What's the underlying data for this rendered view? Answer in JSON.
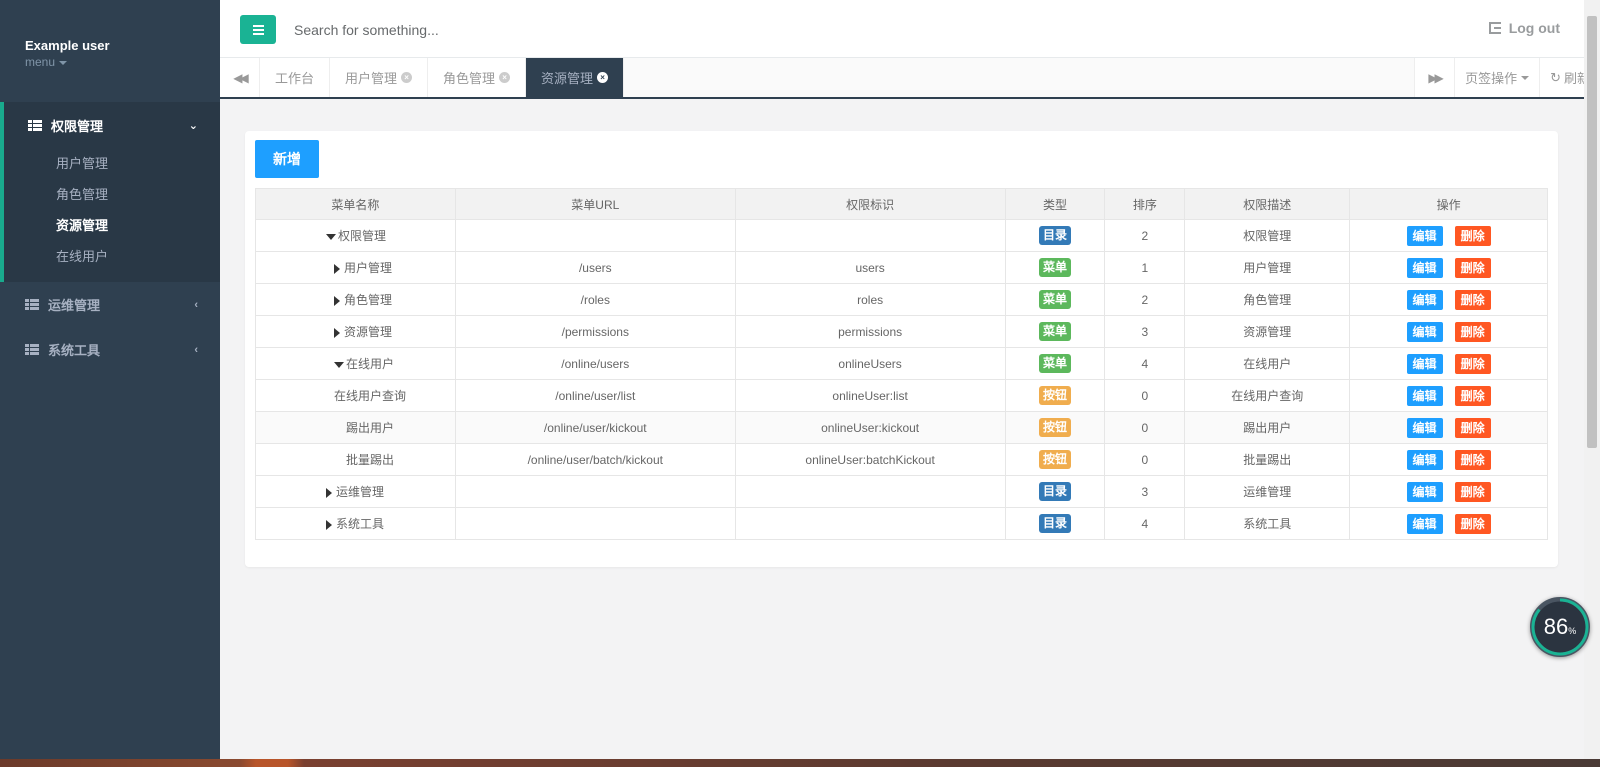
{
  "profile": {
    "name": "Example user",
    "menu_label": "menu"
  },
  "sidebar": {
    "groups": [
      {
        "label": "权限管理",
        "items": [
          "用户管理",
          "角色管理",
          "资源管理",
          "在线用户"
        ]
      },
      {
        "label": "运维管理"
      },
      {
        "label": "系统工具"
      }
    ]
  },
  "topbar": {
    "search_placeholder": "Search for something...",
    "logout_label": "Log out"
  },
  "tabs": {
    "items": [
      "工作台",
      "用户管理",
      "角色管理",
      "资源管理"
    ],
    "active_index": 3,
    "page_ops_label": "页签操作",
    "refresh_label": "刷新"
  },
  "toolbar": {
    "add_label": "新增"
  },
  "table": {
    "headers": [
      "菜单名称",
      "菜单URL",
      "权限标识",
      "类型",
      "排序",
      "权限描述",
      "操作"
    ],
    "edit_label": "编辑",
    "delete_label": "删除",
    "rows": [
      {
        "name": "权限管理",
        "url": "",
        "perm": "",
        "type": "目录",
        "type_kind": "dir",
        "sort": "2",
        "desc": "权限管理",
        "toggle": "down"
      },
      {
        "name": "用户管理",
        "url": "/users",
        "perm": "users",
        "type": "菜单",
        "type_kind": "menu",
        "sort": "1",
        "desc": "用户管理",
        "toggle": "right"
      },
      {
        "name": "角色管理",
        "url": "/roles",
        "perm": "roles",
        "type": "菜单",
        "type_kind": "menu",
        "sort": "2",
        "desc": "角色管理",
        "toggle": "right"
      },
      {
        "name": "资源管理",
        "url": "/permissions",
        "perm": "permissions",
        "type": "菜单",
        "type_kind": "menu",
        "sort": "3",
        "desc": "资源管理",
        "toggle": "right"
      },
      {
        "name": "在线用户",
        "url": "/online/users",
        "perm": "onlineUsers",
        "type": "菜单",
        "type_kind": "menu",
        "sort": "4",
        "desc": "在线用户",
        "toggle": "down"
      },
      {
        "name": "在线用户查询",
        "url": "/online/user/list",
        "perm": "onlineUser:list",
        "type": "按钮",
        "type_kind": "button",
        "sort": "0",
        "desc": "在线用户查询",
        "toggle": ""
      },
      {
        "name": "踢出用户",
        "url": "/online/user/kickout",
        "perm": "onlineUser:kickout",
        "type": "按钮",
        "type_kind": "button",
        "sort": "0",
        "desc": "踢出用户",
        "toggle": ""
      },
      {
        "name": "批量踢出",
        "url": "/online/user/batch/kickout",
        "perm": "onlineUser:batchKickout",
        "type": "按钮",
        "type_kind": "button",
        "sort": "0",
        "desc": "批量踢出",
        "toggle": ""
      },
      {
        "name": "运维管理",
        "url": "",
        "perm": "",
        "type": "目录",
        "type_kind": "dir",
        "sort": "3",
        "desc": "运维管理",
        "toggle": "right"
      },
      {
        "name": "系统工具",
        "url": "",
        "perm": "",
        "type": "目录",
        "type_kind": "dir",
        "sort": "4",
        "desc": "系统工具",
        "toggle": "right"
      }
    ]
  },
  "gauge": {
    "value": "86",
    "unit": "%"
  },
  "colors": {
    "accent": "#1ab394",
    "sidebar_bg": "#2f4050",
    "primary_btn": "#1e9fff",
    "danger_btn": "#ff5722"
  }
}
